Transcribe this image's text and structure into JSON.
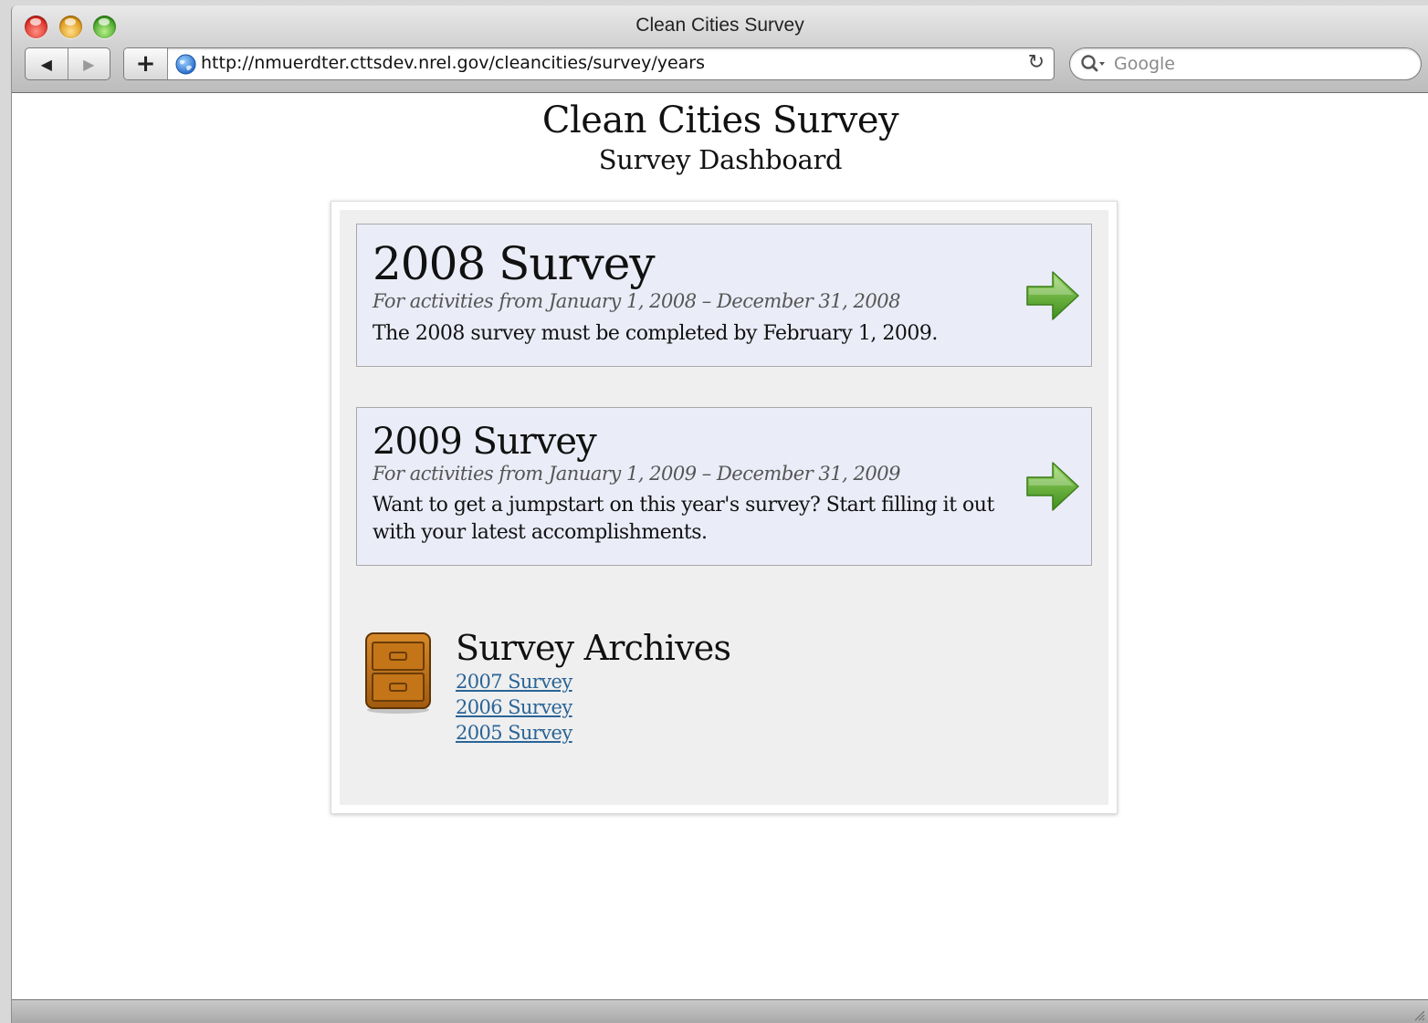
{
  "window": {
    "title": "Clean Cities Survey"
  },
  "toolbar": {
    "back_label": "◀",
    "forward_label": "▶",
    "add_label": "+",
    "url": "http://nmuerdter.cttsdev.nrel.gov/cleancities/survey/years",
    "reload_label": "↻",
    "search_placeholder": "Google"
  },
  "page": {
    "title": "Clean Cities Survey",
    "subtitle": "Survey Dashboard"
  },
  "surveys": [
    {
      "title": "2008 Survey",
      "dates": "For activities from January 1, 2008 – December 31, 2008",
      "description": "The 2008 survey must be completed by February 1, 2009."
    },
    {
      "title": "2009 Survey",
      "dates": "For activities from January 1, 2009 – December 31, 2009",
      "description": "Want to get a jumpstart on this year's survey? Start filling it out with your latest accomplishments."
    }
  ],
  "archives": {
    "title": "Survey Archives",
    "links": [
      "2007 Survey",
      "2006 Survey",
      "2005 Survey"
    ]
  },
  "icons": {
    "traffic_lights": [
      "close-icon",
      "minimize-icon",
      "zoom-icon"
    ],
    "globe": "globe-icon",
    "search": "magnifier-icon",
    "arrow": "green-arrow-right-icon",
    "archive": "filing-cabinet-icon"
  },
  "colors": {
    "card_background": "#eaecf7",
    "panel_background": "#efefef",
    "link": "#2a6496",
    "arrow_green": "#5cab2f"
  }
}
